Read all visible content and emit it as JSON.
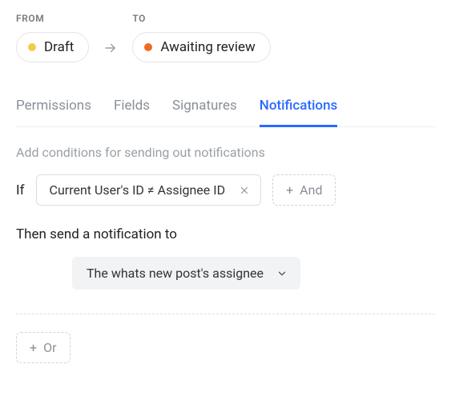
{
  "header": {
    "from_label": "FROM",
    "to_label": "TO",
    "from_status": "Draft",
    "to_status": "Awaiting review"
  },
  "tabs": {
    "items": [
      {
        "label": "Permissions"
      },
      {
        "label": "Fields"
      },
      {
        "label": "Signatures"
      },
      {
        "label": "Notifications"
      }
    ],
    "active_index": 3
  },
  "conditions": {
    "hint": "Add conditions for sending out notifications",
    "if_label": "If",
    "condition_text": "Current User's ID ≠ Assignee ID",
    "and_label": "And",
    "then_label": "Then send a notification to",
    "recipient": "The whats new post's assignee",
    "or_label": "Or"
  }
}
